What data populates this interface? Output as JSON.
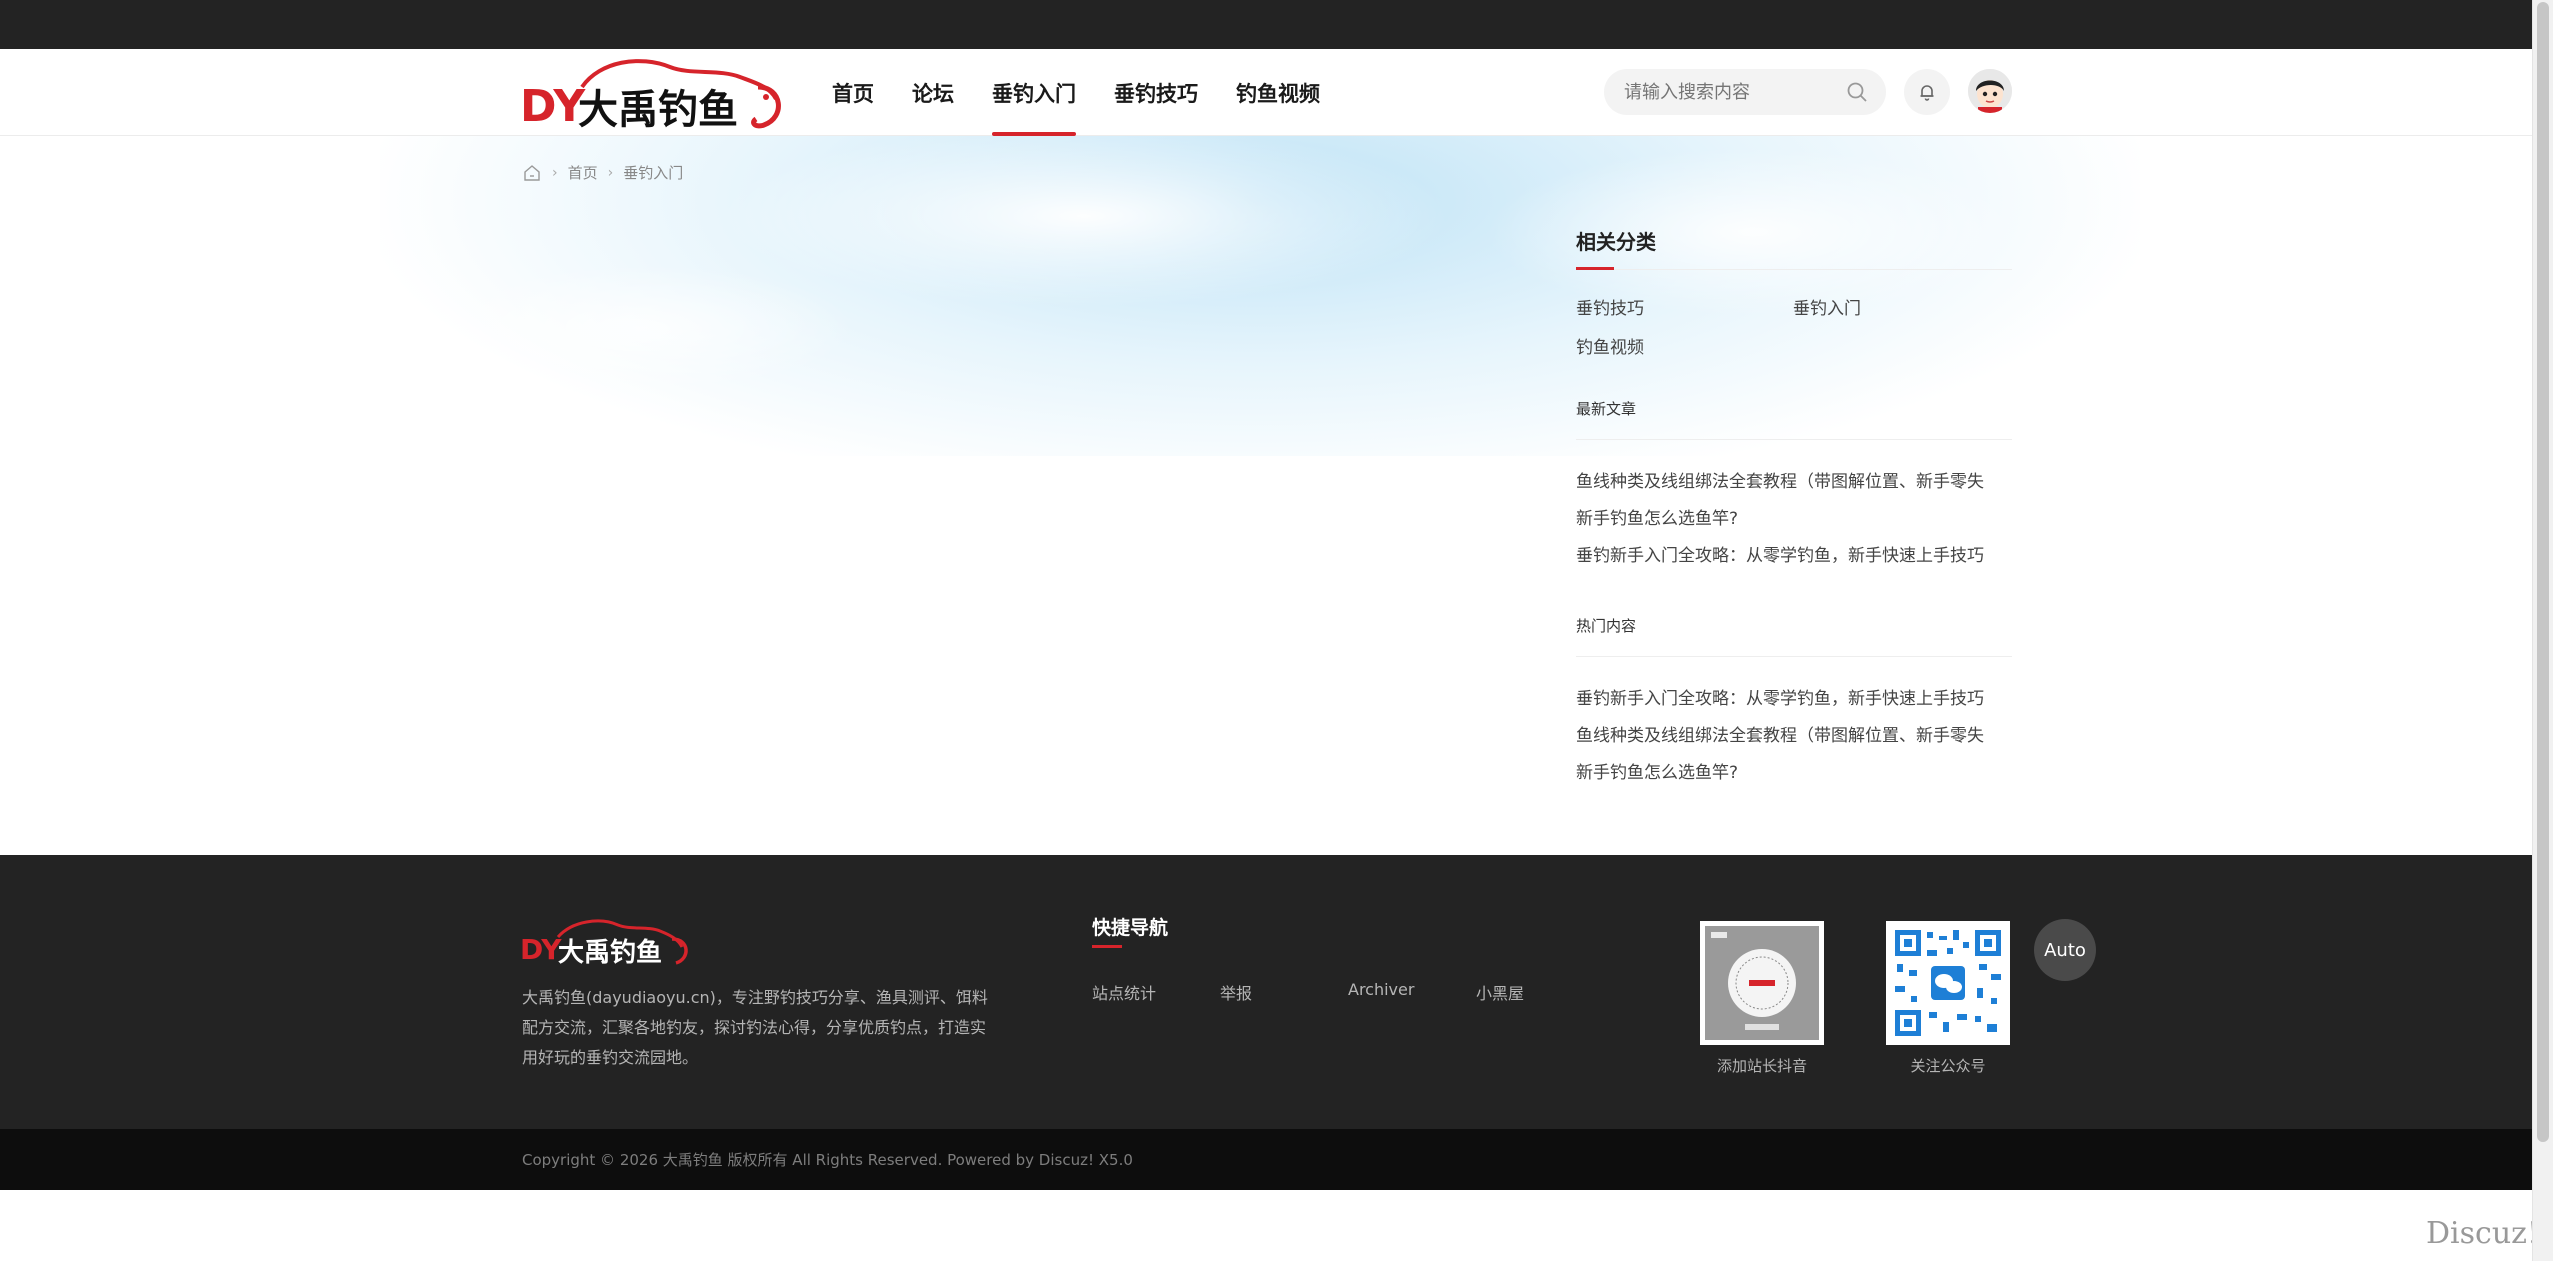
{
  "header": {
    "logo_alt": "大禹钓鱼",
    "nav": [
      {
        "label": "首页",
        "active": false
      },
      {
        "label": "论坛",
        "active": false
      },
      {
        "label": "垂钓入门",
        "active": true
      },
      {
        "label": "垂钓技巧",
        "active": false
      },
      {
        "label": "钓鱼视频",
        "active": false
      }
    ],
    "search_placeholder": "请输入搜索内容",
    "icons": {
      "search": "search-icon",
      "bell": "bell-icon",
      "avatar": "avatar"
    }
  },
  "breadcrumb": [
    "首页",
    "垂钓入门"
  ],
  "sidebar": {
    "related_title": "相关分类",
    "categories": [
      "垂钓技巧",
      "垂钓入门",
      "钓鱼视频"
    ],
    "latest_title": "最新文章",
    "latest": [
      "鱼线种类及线组绑法全套教程（带图解位置、新手零失",
      "新手钓鱼怎么选鱼竿?",
      "垂钓新手入门全攻略：从零学钓鱼，新手快速上手技巧"
    ],
    "hot_title": "热门内容",
    "hot": [
      "垂钓新手入门全攻略：从零学钓鱼，新手快速上手技巧",
      "鱼线种类及线组绑法全套教程（带图解位置、新手零失",
      "新手钓鱼怎么选鱼竿?"
    ]
  },
  "footer": {
    "description": "大禹钓鱼(dayudiaoyu.cn)，专注野钓技巧分享、渔具测评、饵料配方交流，汇聚各地钓友，探讨钓法心得，分享优质钓点，打造实用好玩的垂钓交流园地。",
    "quicknav_title": "快捷导航",
    "quicknav": [
      "站点统计",
      "举报",
      "Archiver",
      "小黑屋"
    ],
    "qr_douyin_label": "添加站长抖音",
    "qr_wechat_label": "关注公众号",
    "auto_label": "Auto",
    "copyright": "Copyright © 2026 大禹钓鱼 版权所有 All Rights Reserved. Powered by Discuz! X5.0"
  },
  "watermark": "Discuz!",
  "colors": {
    "accent": "#d6242b",
    "topbar": "#232323",
    "footer": "#232323",
    "copyright_bg": "#0d0d0d"
  }
}
